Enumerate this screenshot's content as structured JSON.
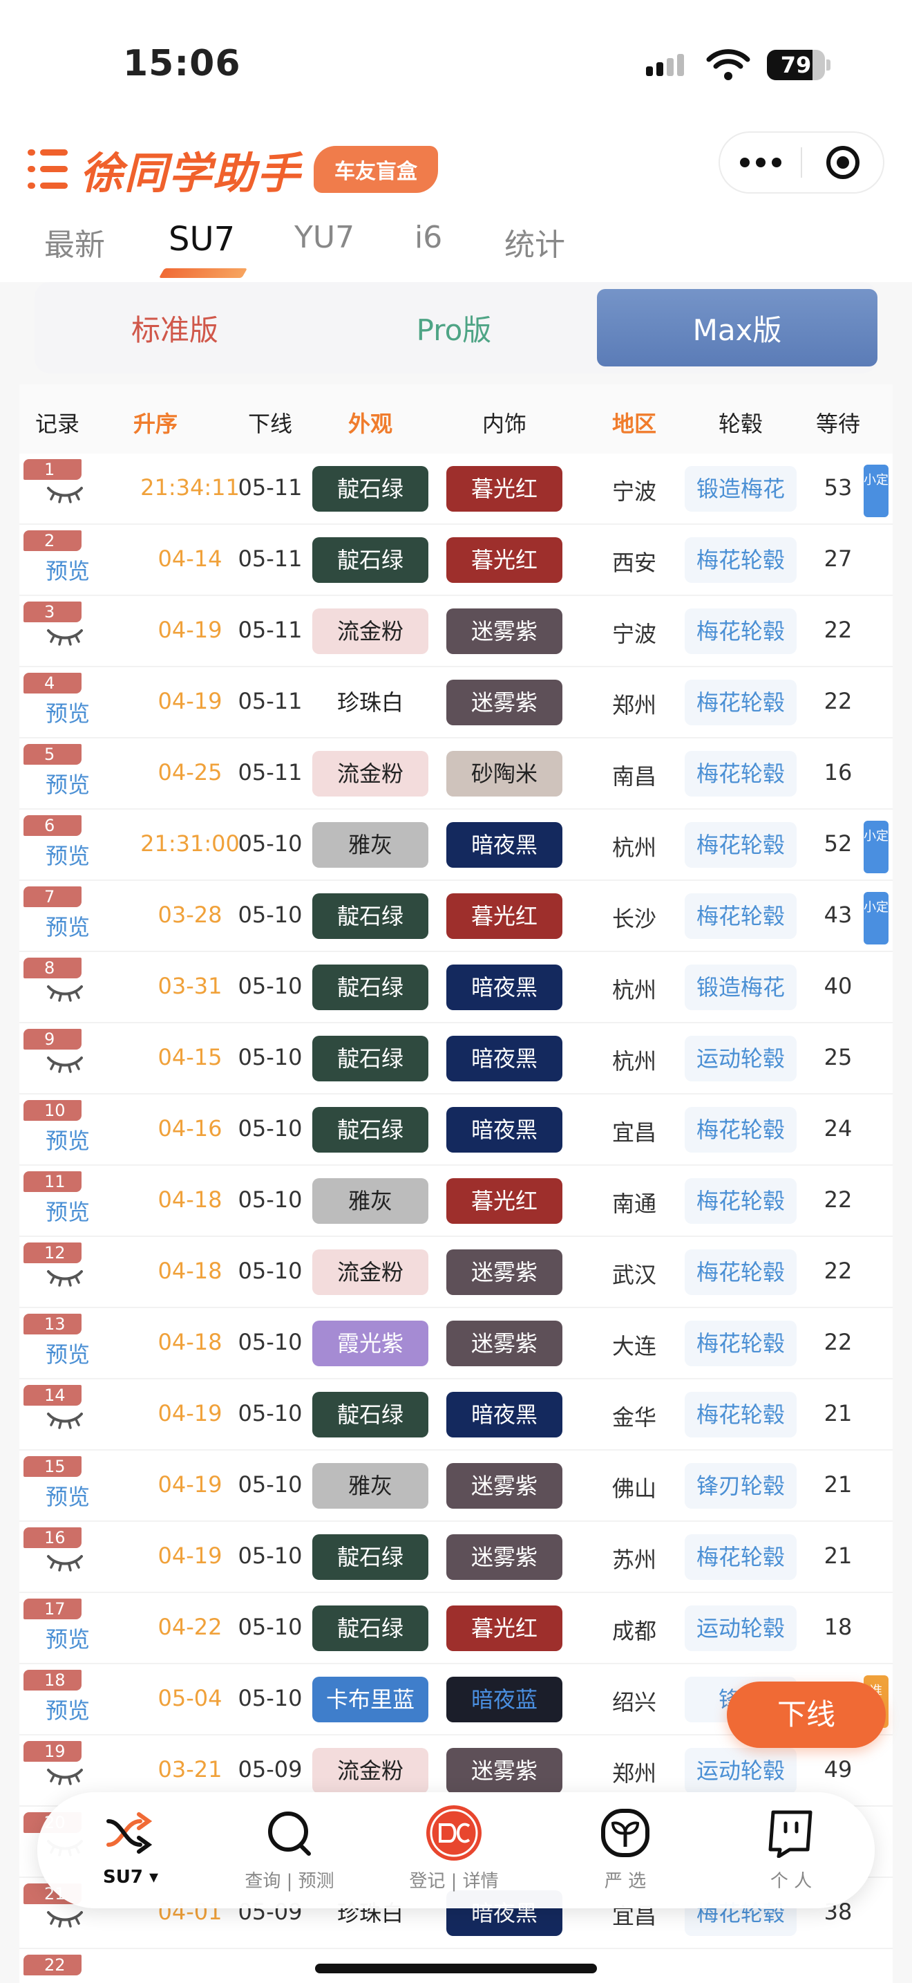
{
  "status_bar": {
    "time": "15:06",
    "battery": "79",
    "battery_level": 0.79
  },
  "app": {
    "title": "徐同学助手",
    "badge": "车友盲盒"
  },
  "tabs": [
    {
      "label": "最新"
    },
    {
      "label": "SU7"
    },
    {
      "label": "YU7"
    },
    {
      "label": "i6"
    },
    {
      "label": "统计"
    }
  ],
  "versions": [
    {
      "label": "标准版"
    },
    {
      "label": "Pro版"
    },
    {
      "label": "Max版"
    }
  ],
  "columns": [
    "记录",
    "升序",
    "下线",
    "外观",
    "内饰",
    "地区",
    "轮毂",
    "等待"
  ],
  "rows": [
    {
      "n": "1",
      "rec": "",
      "rec_type": "eye",
      "asc": "21:34:11",
      "off": "05-11",
      "ext": "靛石绿",
      "int": "暮光红",
      "reg": "宁波",
      "whl": "锻造梅花",
      "wait": "53",
      "tag": "小定",
      "tag_color": "blue"
    },
    {
      "n": "2",
      "rec": "预览",
      "rec_type": "link",
      "asc": "04-14",
      "off": "05-11",
      "ext": "靛石绿",
      "int": "暮光红",
      "reg": "西安",
      "whl": "梅花轮毂",
      "wait": "27",
      "tag": "",
      "tag_color": ""
    },
    {
      "n": "3",
      "rec": "",
      "rec_type": "eye",
      "asc": "04-19",
      "off": "05-11",
      "ext": "流金粉",
      "int": "迷雾紫",
      "reg": "宁波",
      "whl": "梅花轮毂",
      "wait": "22",
      "tag": "",
      "tag_color": ""
    },
    {
      "n": "4",
      "rec": "预览",
      "rec_type": "link",
      "asc": "04-19",
      "off": "05-11",
      "ext": "珍珠白",
      "int": "迷雾紫",
      "reg": "郑州",
      "whl": "梅花轮毂",
      "wait": "22",
      "tag": "",
      "tag_color": ""
    },
    {
      "n": "5",
      "rec": "预览",
      "rec_type": "link",
      "asc": "04-25",
      "off": "05-11",
      "ext": "流金粉",
      "int": "砂陶米",
      "reg": "南昌",
      "whl": "梅花轮毂",
      "wait": "16",
      "tag": "",
      "tag_color": ""
    },
    {
      "n": "6",
      "rec": "预览",
      "rec_type": "link",
      "asc": "21:31:00",
      "off": "05-10",
      "ext": "雅灰",
      "int": "暗夜黑",
      "reg": "杭州",
      "whl": "梅花轮毂",
      "wait": "52",
      "tag": "小定",
      "tag_color": "blue"
    },
    {
      "n": "7",
      "rec": "预览",
      "rec_type": "link",
      "asc": "03-28",
      "off": "05-10",
      "ext": "靛石绿",
      "int": "暮光红",
      "reg": "长沙",
      "whl": "梅花轮毂",
      "wait": "43",
      "tag": "小定",
      "tag_color": "blue"
    },
    {
      "n": "8",
      "rec": "",
      "rec_type": "eye",
      "asc": "03-31",
      "off": "05-10",
      "ext": "靛石绿",
      "int": "暗夜黑",
      "reg": "杭州",
      "whl": "锻造梅花",
      "wait": "40",
      "tag": "",
      "tag_color": ""
    },
    {
      "n": "9",
      "rec": "",
      "rec_type": "eye",
      "asc": "04-15",
      "off": "05-10",
      "ext": "靛石绿",
      "int": "暗夜黑",
      "reg": "杭州",
      "whl": "运动轮毂",
      "wait": "25",
      "tag": "",
      "tag_color": ""
    },
    {
      "n": "10",
      "rec": "预览",
      "rec_type": "link",
      "asc": "04-16",
      "off": "05-10",
      "ext": "靛石绿",
      "int": "暗夜黑",
      "reg": "宜昌",
      "whl": "梅花轮毂",
      "wait": "24",
      "tag": "",
      "tag_color": ""
    },
    {
      "n": "11",
      "rec": "预览",
      "rec_type": "link",
      "asc": "04-18",
      "off": "05-10",
      "ext": "雅灰",
      "int": "暮光红",
      "reg": "南通",
      "whl": "梅花轮毂",
      "wait": "22",
      "tag": "",
      "tag_color": ""
    },
    {
      "n": "12",
      "rec": "",
      "rec_type": "eye",
      "asc": "04-18",
      "off": "05-10",
      "ext": "流金粉",
      "int": "迷雾紫",
      "reg": "武汉",
      "whl": "梅花轮毂",
      "wait": "22",
      "tag": "",
      "tag_color": ""
    },
    {
      "n": "13",
      "rec": "预览",
      "rec_type": "link",
      "asc": "04-18",
      "off": "05-10",
      "ext": "霞光紫",
      "int": "迷雾紫",
      "reg": "大连",
      "whl": "梅花轮毂",
      "wait": "22",
      "tag": "",
      "tag_color": ""
    },
    {
      "n": "14",
      "rec": "",
      "rec_type": "eye",
      "asc": "04-19",
      "off": "05-10",
      "ext": "靛石绿",
      "int": "暗夜黑",
      "reg": "金华",
      "whl": "梅花轮毂",
      "wait": "21",
      "tag": "",
      "tag_color": ""
    },
    {
      "n": "15",
      "rec": "预览",
      "rec_type": "link",
      "asc": "04-19",
      "off": "05-10",
      "ext": "雅灰",
      "int": "迷雾紫",
      "reg": "佛山",
      "whl": "锋刃轮毂",
      "wait": "21",
      "tag": "",
      "tag_color": ""
    },
    {
      "n": "16",
      "rec": "",
      "rec_type": "eye",
      "asc": "04-19",
      "off": "05-10",
      "ext": "靛石绿",
      "int": "迷雾紫",
      "reg": "苏州",
      "whl": "梅花轮毂",
      "wait": "21",
      "tag": "",
      "tag_color": ""
    },
    {
      "n": "17",
      "rec": "预览",
      "rec_type": "link",
      "asc": "04-22",
      "off": "05-10",
      "ext": "靛石绿",
      "int": "暮光红",
      "reg": "成都",
      "whl": "运动轮毂",
      "wait": "18",
      "tag": "",
      "tag_color": ""
    },
    {
      "n": "18",
      "rec": "预览",
      "rec_type": "link",
      "asc": "05-04",
      "off": "05-10",
      "ext": "卡布里蓝",
      "int": "暗夜蓝",
      "reg": "绍兴",
      "whl": "锋刃",
      "wait": "",
      "tag": "准",
      "tag_color": "orange"
    },
    {
      "n": "19",
      "rec": "",
      "rec_type": "eye",
      "asc": "03-21",
      "off": "05-09",
      "ext": "流金粉",
      "int": "迷雾紫",
      "reg": "郑州",
      "whl": "运动轮毂",
      "wait": "49",
      "tag": "",
      "tag_color": ""
    },
    {
      "n": "20",
      "rec": "",
      "rec_type": "eye",
      "asc": "",
      "off": "",
      "ext": "",
      "int": "",
      "reg": "",
      "whl": "",
      "wait": "",
      "tag": "",
      "tag_color": ""
    },
    {
      "n": "21",
      "rec": "",
      "rec_type": "eye",
      "asc": "04-01",
      "off": "05-09",
      "ext": "珍珠白",
      "int": "暗夜黑",
      "reg": "宜昌",
      "whl": "梅花轮毂",
      "wait": "38",
      "tag": "",
      "tag_color": ""
    },
    {
      "n": "22",
      "rec": "",
      "rec_type": "link",
      "asc": "",
      "off": "",
      "ext": "",
      "int": "",
      "reg": "",
      "whl": "",
      "wait": "",
      "tag": "",
      "tag_color": ""
    }
  ],
  "color_styles": {
    "靛石绿": {
      "bg": "#2f4a3f",
      "fg": "#ffffff"
    },
    "暮光红": {
      "bg": "#9e2f2c",
      "fg": "#ffffff"
    },
    "流金粉": {
      "bg": "#f3dcdc",
      "fg": "#222222"
    },
    "迷雾紫": {
      "bg": "#5e5058",
      "fg": "#ffffff"
    },
    "珍珠白": {
      "bg": "#ffffff",
      "fg": "#222222"
    },
    "砂陶米": {
      "bg": "#cfc3bc",
      "fg": "#222222"
    },
    "雅灰": {
      "bg": "#bcbcbc",
      "fg": "#222222"
    },
    "暗夜黑": {
      "bg": "#14295e",
      "fg": "#ffffff"
    },
    "霞光紫": {
      "bg": "#a58bd3",
      "fg": "#ffffff"
    },
    "卡布里蓝": {
      "bg": "#3f7ecb",
      "fg": "#ffffff"
    },
    "暗夜蓝": {
      "bg": "#1b1e2a",
      "fg": "#4a8fe0"
    }
  },
  "fab": {
    "label": "下线"
  },
  "bottom_nav": [
    {
      "label": "SU7 ▾",
      "icon": "shuffle-icon"
    },
    {
      "label": "查询 | 预测",
      "icon": "search-icon"
    },
    {
      "label": "登记 | 详情",
      "icon": "register-logo-icon"
    },
    {
      "label": "严 选",
      "icon": "sprout-icon"
    },
    {
      "label": "个 人",
      "icon": "profile-icon"
    }
  ]
}
